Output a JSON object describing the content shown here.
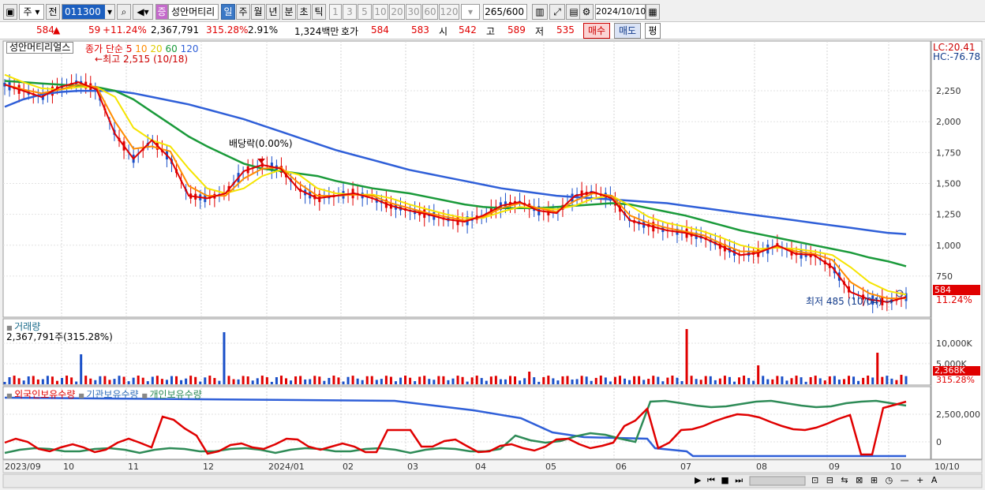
{
  "toolbar": {
    "period_main": "주",
    "prev_label": "전",
    "code": "011300",
    "badge": "증",
    "name": "성안머티리",
    "periods": [
      "일",
      "주",
      "월",
      "년",
      "분",
      "초",
      "틱"
    ],
    "active_period": "일",
    "intervals": [
      "1",
      "3",
      "5",
      "10",
      "20",
      "30",
      "60",
      "120"
    ],
    "count": "265",
    "count_total": "/600",
    "date": "2024/10/10"
  },
  "quote": {
    "price": "584",
    "change": "59",
    "change_pct": "+11.24%",
    "volume": "2,367,791",
    "volume_ratio": "315.28%",
    "turnover": "2.91%",
    "amount": "1,324백만",
    "hoga_label": "호가",
    "ask": "584",
    "bid": "583",
    "open_label": "시",
    "open": "542",
    "high_label": "고",
    "high": "589",
    "low_label": "저",
    "low": "535",
    "buy_label": "매수",
    "sell_label": "매도",
    "eval_label": "평"
  },
  "panels": {
    "price_title": "성안머티리얼스",
    "ma_legend_label": "종가 단순",
    "ma_periods": [
      "5",
      "10",
      "20",
      "60",
      "120"
    ],
    "high_marker": "최고 2,515 (10/18)",
    "low_marker": "최저 485 (10/04)",
    "dividend_label": "배당락(0.00%)",
    "lc": "LC:20.41",
    "hc": "HC:-76.78",
    "price_tag": "584",
    "price_tag_pct": "11.24%",
    "volume_title": "거래량",
    "volume_info": "2,367,791주(315.28%)",
    "volume_tag": "2,368K",
    "volume_tag_pct": "315.28%",
    "holdings_legend": [
      "외국인보유수량",
      "기관보유수량",
      "개인보유수량"
    ]
  },
  "colors": {
    "ma5": "#e00000",
    "ma10": "#ff8c00",
    "ma20": "#f5e400",
    "ma60": "#1a9a3a",
    "ma120": "#2f5fd8",
    "up": "#e00000",
    "down": "#1a4fc8",
    "foreign": "#2f5fd8",
    "institution": "#e00000",
    "individual": "#2e8b57"
  },
  "chart_data": {
    "type": "line",
    "x": [
      "2023/09",
      "10",
      "11",
      "12",
      "2024/01",
      "02",
      "03",
      "04",
      "05",
      "06",
      "07",
      "08",
      "09",
      "10",
      "10/10"
    ],
    "price_axis": [
      2250,
      2000,
      1750,
      1500,
      1250,
      1000,
      750
    ],
    "price_axis_labels": [
      "2,250",
      "2,000",
      "1,750",
      "1,500",
      "1,250",
      "1,000",
      "750"
    ],
    "ylim": [
      430,
      2640
    ],
    "volume_axis": [
      10000,
      5000
    ],
    "volume_axis_labels": [
      "10,000K",
      "5,000K"
    ],
    "holdings_axis": [
      2500000,
      0
    ],
    "holdings_axis_labels": [
      "2,500,000",
      "0"
    ],
    "series": [
      {
        "name": "5",
        "values": [
          2300,
          2250,
          2200,
          2280,
          2320,
          2260,
          1900,
          1700,
          1850,
          1700,
          1400,
          1380,
          1420,
          1600,
          1650,
          1620,
          1450,
          1380,
          1400,
          1420,
          1380,
          1320,
          1280,
          1250,
          1210,
          1190,
          1240,
          1320,
          1350,
          1280,
          1260,
          1400,
          1430,
          1380,
          1200,
          1160,
          1120,
          1100,
          1060,
          990,
          920,
          940,
          1000,
          930,
          920,
          820,
          620,
          560,
          540,
          580
        ]
      },
      {
        "name": "10",
        "values": [
          2300,
          2260,
          2230,
          2260,
          2300,
          2280,
          2000,
          1780,
          1800,
          1760,
          1480,
          1400,
          1400,
          1540,
          1620,
          1630,
          1500,
          1400,
          1400,
          1410,
          1400,
          1340,
          1300,
          1260,
          1230,
          1200,
          1230,
          1300,
          1340,
          1300,
          1270,
          1360,
          1420,
          1400,
          1240,
          1180,
          1140,
          1110,
          1080,
          1010,
          950,
          950,
          990,
          950,
          930,
          880,
          700,
          610,
          570,
          570
        ]
      },
      {
        "name": "20",
        "values": [
          2380,
          2320,
          2270,
          2260,
          2280,
          2280,
          2200,
          1950,
          1850,
          1800,
          1620,
          1460,
          1420,
          1460,
          1560,
          1610,
          1570,
          1460,
          1420,
          1410,
          1410,
          1380,
          1330,
          1290,
          1250,
          1220,
          1220,
          1270,
          1310,
          1300,
          1290,
          1320,
          1380,
          1400,
          1320,
          1230,
          1180,
          1150,
          1110,
          1060,
          1000,
          970,
          980,
          970,
          950,
          920,
          820,
          700,
          630,
          600
        ]
      },
      {
        "name": "60",
        "values": [
          2330,
          2320,
          2310,
          2300,
          2290,
          2280,
          2250,
          2180,
          2080,
          1980,
          1880,
          1800,
          1730,
          1660,
          1620,
          1600,
          1580,
          1560,
          1520,
          1490,
          1460,
          1440,
          1420,
          1390,
          1360,
          1330,
          1310,
          1300,
          1300,
          1300,
          1310,
          1320,
          1330,
          1340,
          1330,
          1300,
          1270,
          1240,
          1200,
          1160,
          1120,
          1090,
          1060,
          1030,
          1000,
          970,
          940,
          900,
          870,
          830
        ]
      },
      {
        "name": "120",
        "values": [
          2120,
          2180,
          2220,
          2240,
          2250,
          2250,
          2250,
          2230,
          2200,
          2170,
          2140,
          2100,
          2060,
          2020,
          1970,
          1920,
          1870,
          1820,
          1770,
          1730,
          1690,
          1650,
          1610,
          1580,
          1550,
          1520,
          1490,
          1460,
          1440,
          1420,
          1400,
          1390,
          1380,
          1370,
          1360,
          1350,
          1340,
          1320,
          1300,
          1280,
          1260,
          1240,
          1220,
          1200,
          1180,
          1160,
          1140,
          1120,
          1100,
          1090
        ]
      }
    ]
  }
}
